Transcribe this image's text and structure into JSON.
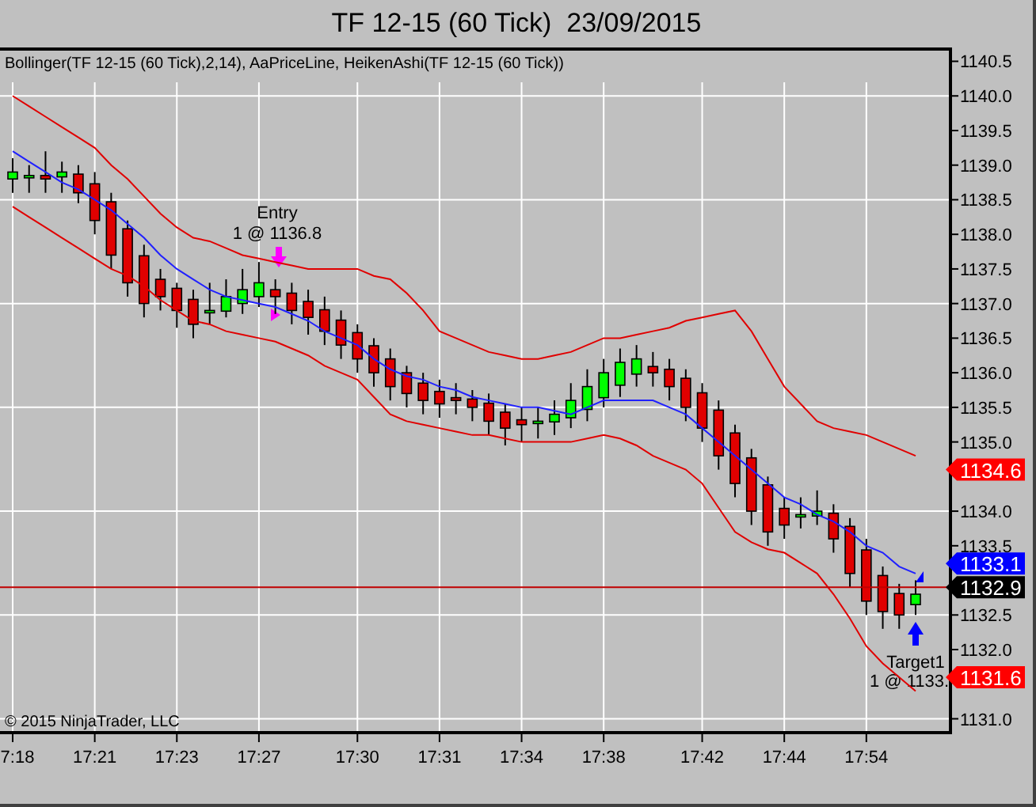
{
  "window": {
    "title": "TF 12-15 (60 Tick)  23/09/2015"
  },
  "chart": {
    "legend": "Bollinger(TF 12-15 (60 Tick),2,14), AaPriceLine, HeikenAshi(TF 12-15 (60 Tick))",
    "copyright": "© 2015 NinjaTrader, LLC",
    "chart_data": {
      "type": "candlestick",
      "categories": [
        "7:18",
        null,
        null,
        null,
        null,
        "17:21",
        null,
        null,
        null,
        null,
        "17:23",
        null,
        null,
        null,
        null,
        "17:27",
        null,
        null,
        null,
        null,
        null,
        "17:30",
        null,
        null,
        null,
        null,
        "17:31",
        null,
        null,
        null,
        null,
        "17:34",
        null,
        null,
        null,
        null,
        "17:38",
        null,
        null,
        null,
        null,
        null,
        "17:42",
        null,
        null,
        null,
        null,
        "17:44",
        null,
        null,
        null,
        null,
        "17:54",
        null,
        null,
        null
      ],
      "ylim": [
        1130.8,
        1140.7
      ],
      "grid": true,
      "ref_lines": [
        {
          "axis": "y",
          "value": 1132.9,
          "color": "#c00000"
        }
      ],
      "yticks": [
        {
          "value": 1140.5,
          "label": "1140.5"
        },
        {
          "value": 1140,
          "label": "1140.0"
        },
        {
          "value": 1139.5,
          "label": "1139.5"
        },
        {
          "value": 1139,
          "label": "1139.0"
        },
        {
          "value": 1138.5,
          "label": "1138.5"
        },
        {
          "value": 1138,
          "label": "1138.0"
        },
        {
          "value": 1137.5,
          "label": "1137.5"
        },
        {
          "value": 1137,
          "label": "1137.0"
        },
        {
          "value": 1136.5,
          "label": "1136.5"
        },
        {
          "value": 1136,
          "label": "1136.0"
        },
        {
          "value": 1135.5,
          "label": "1135.5"
        },
        {
          "value": 1135,
          "label": "1135.0"
        },
        {
          "value": 1134,
          "label": "1134.0"
        },
        {
          "value": 1133.5,
          "label": "1133.5"
        },
        {
          "value": 1132.5,
          "label": "1132.5"
        },
        {
          "value": 1132,
          "label": "1132.0"
        },
        {
          "value": 1131,
          "label": "1131.0"
        }
      ],
      "ohlc": [
        [
          1138.8,
          1139.1,
          1138.6,
          1138.9
        ],
        [
          1138.85,
          1139.0,
          1138.6,
          1138.85
        ],
        [
          1138.85,
          1139.2,
          1138.6,
          1138.8
        ],
        [
          1138.83,
          1139.05,
          1138.6,
          1138.9
        ],
        [
          1138.87,
          1139.0,
          1138.45,
          1138.6
        ],
        [
          1138.73,
          1138.9,
          1138.0,
          1138.2
        ],
        [
          1138.47,
          1138.6,
          1137.5,
          1137.7
        ],
        [
          1138.08,
          1138.2,
          1137.1,
          1137.3
        ],
        [
          1137.69,
          1137.85,
          1136.8,
          1137.0
        ],
        [
          1137.35,
          1137.5,
          1136.9,
          1137.1
        ],
        [
          1137.22,
          1137.3,
          1136.65,
          1136.9
        ],
        [
          1137.06,
          1137.2,
          1136.5,
          1136.7
        ],
        [
          1136.88,
          1137.3,
          1136.7,
          1136.9
        ],
        [
          1136.89,
          1137.35,
          1136.8,
          1137.1
        ],
        [
          1137.0,
          1137.5,
          1136.85,
          1137.2
        ],
        [
          1137.1,
          1137.6,
          1136.95,
          1137.3
        ],
        [
          1137.2,
          1137.35,
          1136.85,
          1137.1
        ],
        [
          1137.15,
          1137.3,
          1136.7,
          1136.9
        ],
        [
          1137.03,
          1137.2,
          1136.55,
          1136.8
        ],
        [
          1136.91,
          1137.1,
          1136.4,
          1136.6
        ],
        [
          1136.76,
          1136.9,
          1136.2,
          1136.4
        ],
        [
          1136.58,
          1136.7,
          1136.0,
          1136.2
        ],
        [
          1136.39,
          1136.5,
          1135.8,
          1136.0
        ],
        [
          1136.2,
          1136.35,
          1135.6,
          1135.8
        ],
        [
          1136.0,
          1136.1,
          1135.5,
          1135.7
        ],
        [
          1135.85,
          1136.0,
          1135.4,
          1135.6
        ],
        [
          1135.73,
          1135.9,
          1135.35,
          1135.55
        ],
        [
          1135.64,
          1135.85,
          1135.4,
          1135.6
        ],
        [
          1135.62,
          1135.75,
          1135.3,
          1135.5
        ],
        [
          1135.56,
          1135.7,
          1135.1,
          1135.3
        ],
        [
          1135.43,
          1135.55,
          1134.95,
          1135.2
        ],
        [
          1135.32,
          1135.5,
          1135.0,
          1135.25
        ],
        [
          1135.28,
          1135.5,
          1135.05,
          1135.3
        ],
        [
          1135.29,
          1135.6,
          1135.1,
          1135.4
        ],
        [
          1135.35,
          1135.85,
          1135.2,
          1135.6
        ],
        [
          1135.47,
          1136.05,
          1135.3,
          1135.8
        ],
        [
          1135.64,
          1136.2,
          1135.5,
          1136.0
        ],
        [
          1135.82,
          1136.35,
          1135.65,
          1136.15
        ],
        [
          1135.98,
          1136.4,
          1135.8,
          1136.2
        ],
        [
          1136.09,
          1136.3,
          1135.8,
          1136.0
        ],
        [
          1136.05,
          1136.2,
          1135.6,
          1135.8
        ],
        [
          1135.92,
          1136.05,
          1135.3,
          1135.5
        ],
        [
          1135.71,
          1135.85,
          1135.0,
          1135.2
        ],
        [
          1135.46,
          1135.6,
          1134.6,
          1134.8
        ],
        [
          1135.13,
          1135.25,
          1134.2,
          1134.4
        ],
        [
          1134.77,
          1134.9,
          1133.8,
          1134.0
        ],
        [
          1134.38,
          1134.5,
          1133.5,
          1133.7
        ],
        [
          1134.04,
          1134.2,
          1133.6,
          1133.8
        ],
        [
          1133.92,
          1134.2,
          1133.75,
          1133.95
        ],
        [
          1133.93,
          1134.3,
          1133.8,
          1134.0
        ],
        [
          1133.97,
          1134.1,
          1133.4,
          1133.6
        ],
        [
          1133.78,
          1133.9,
          1132.9,
          1133.1
        ],
        [
          1133.44,
          1133.6,
          1132.5,
          1132.7
        ],
        [
          1133.07,
          1133.2,
          1132.3,
          1132.55
        ],
        [
          1132.81,
          1132.95,
          1132.3,
          1132.5
        ],
        [
          1132.65,
          1133.0,
          1132.5,
          1132.8
        ]
      ],
      "series": [
        {
          "type": "line",
          "color": "#e00000",
          "values": [
            1140.0,
            1139.85,
            1139.7,
            1139.55,
            1139.4,
            1139.25,
            1139.0,
            1138.8,
            1138.55,
            1138.3,
            1138.1,
            1137.95,
            1137.9,
            1137.8,
            1137.7,
            1137.65,
            1137.6,
            1137.55,
            1137.5,
            1137.5,
            1137.5,
            1137.5,
            1137.4,
            1137.35,
            1137.15,
            1136.9,
            1136.6,
            1136.5,
            1136.4,
            1136.3,
            1136.25,
            1136.2,
            1136.2,
            1136.25,
            1136.3,
            1136.4,
            1136.5,
            1136.5,
            1136.55,
            1136.6,
            1136.65,
            1136.75,
            1136.8,
            1136.85,
            1136.9,
            1136.6,
            1136.2,
            1135.8,
            1135.55,
            1135.3,
            1135.2,
            1135.15,
            1135.1,
            1135.0,
            1134.9,
            1134.8
          ]
        },
        {
          "type": "line",
          "color": "#2020ff",
          "values": [
            1139.2,
            1139.05,
            1138.9,
            1138.75,
            1138.65,
            1138.5,
            1138.35,
            1138.15,
            1137.95,
            1137.7,
            1137.5,
            1137.35,
            1137.2,
            1137.1,
            1137.05,
            1137.0,
            1136.95,
            1136.85,
            1136.75,
            1136.6,
            1136.5,
            1136.4,
            1136.2,
            1136.05,
            1135.95,
            1135.9,
            1135.8,
            1135.75,
            1135.65,
            1135.6,
            1135.55,
            1135.5,
            1135.5,
            1135.45,
            1135.4,
            1135.5,
            1135.6,
            1135.6,
            1135.6,
            1135.6,
            1135.5,
            1135.4,
            1135.2,
            1135.0,
            1134.8,
            1134.6,
            1134.4,
            1134.2,
            1134.1,
            1133.95,
            1133.85,
            1133.7,
            1133.5,
            1133.4,
            1133.2,
            1133.1
          ]
        },
        {
          "type": "line",
          "color": "#e00000",
          "values": [
            1138.4,
            1138.25,
            1138.1,
            1137.95,
            1137.8,
            1137.65,
            1137.5,
            1137.4,
            1137.25,
            1137.05,
            1136.9,
            1136.75,
            1136.7,
            1136.6,
            1136.55,
            1136.5,
            1136.45,
            1136.35,
            1136.25,
            1136.1,
            1136.0,
            1135.9,
            1135.65,
            1135.4,
            1135.3,
            1135.25,
            1135.2,
            1135.15,
            1135.1,
            1135.1,
            1135.05,
            1135.0,
            1135.0,
            1135.0,
            1135.0,
            1135.05,
            1135.1,
            1135.05,
            1134.95,
            1134.8,
            1134.7,
            1134.6,
            1134.4,
            1134.05,
            1133.7,
            1133.55,
            1133.45,
            1133.4,
            1133.25,
            1133.1,
            1132.8,
            1132.45,
            1132.05,
            1131.8,
            1131.6,
            1131.4
          ]
        }
      ]
    },
    "price_tags": [
      {
        "label": "1134.6",
        "color": "#ff0000"
      },
      {
        "label": "1133.1",
        "color": "#0000ff"
      },
      {
        "label": "1132.9",
        "color": "#000000"
      },
      {
        "label": "1131.6",
        "color": "#ff0000"
      }
    ],
    "markers": [
      {
        "kind": "entry",
        "title": "Entry",
        "detail": "1 @ 1136.8"
      },
      {
        "kind": "exit",
        "title": "Target1",
        "detail": "1 @ 1133."
      }
    ]
  }
}
